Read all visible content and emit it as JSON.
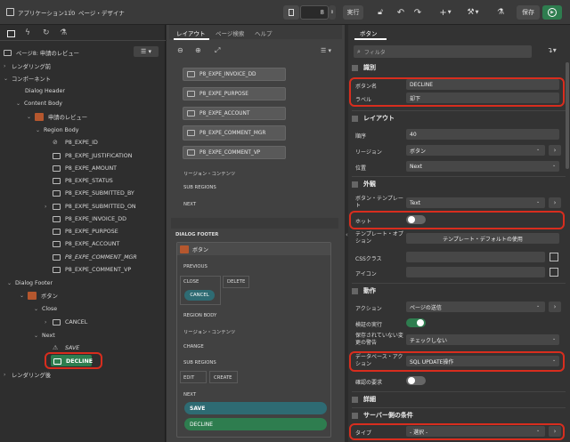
{
  "topbar": {
    "breadcrumb_app": "アプリケーション110",
    "breadcrumb_sep": "\\",
    "breadcrumb_page": "ページ・デザイナ",
    "page_number": "8",
    "run_label": "実行",
    "add_label": "+",
    "save_label": "保存"
  },
  "left": {
    "page_title": "ページ8: 申請のレビュー",
    "items": {
      "rendering_before": "レンダリング前",
      "components": "コンポーネント",
      "dialog_header": "Dialog Header",
      "content_body": "Content Body",
      "region_review": "申請のレビュー",
      "region_body": "Region Body",
      "p8_expe_id": "P8_EXPE_ID",
      "p8_expe_justification": "P8_EXPE_JUSTIFICATION",
      "p8_expe_amount": "P8_EXPE_AMOUNT",
      "p8_expe_status": "P8_EXPE_STATUS",
      "p8_expe_submitted_by": "P8_EXPE_SUBMITTED_BY",
      "p8_expe_submitted_on": "P8_EXPE_SUBMITTED_ON",
      "p8_expe_invoice_dd": "P8_EXPE_INVOICE_DD",
      "p8_expe_purpose": "P8_EXPE_PURPOSE",
      "p8_expe_account": "P8_EXPE_ACCOUNT",
      "p8_expe_comment_mgr": "P8_EXPE_COMMENT_MGR",
      "p8_expe_comment_vp": "P8_EXPE_COMMENT_VP",
      "dialog_footer": "Dialog Footer",
      "region_buttons": "ボタン",
      "close": "Close",
      "cancel": "CANCEL",
      "next": "Next",
      "save": "SAVE",
      "decline": "DECLINE",
      "rendering_after": "レンダリング後"
    }
  },
  "mid": {
    "tabs": [
      "レイアウト",
      "ページ検索",
      "ヘルプ"
    ],
    "items": [
      "P8_EXPE_INVOICE_DD",
      "P8_EXPE_PURPOSE",
      "P8_EXPE_ACCOUNT",
      "P8_EXPE_COMMENT_MGR",
      "P8_EXPE_COMMENT_VP"
    ],
    "region_content": "リージョン・コンテンツ",
    "sub_regions": "SUB REGIONS",
    "next": "NEXT",
    "dialog_footer": "DIALOG FOOTER",
    "buttons_region": "ボタン",
    "previous": "PREVIOUS",
    "close": "CLOSE",
    "delete": "DELETE",
    "cancel": "CANCEL",
    "region_body": "REGION BODY",
    "region_content2": "リージョン・コンテンツ",
    "change": "CHANGE",
    "sub_regions2": "SUB REGIONS",
    "edit": "EDIT",
    "create": "CREATE",
    "next2": "NEXT",
    "save": "SAVE",
    "decline": "DECLINE"
  },
  "right": {
    "tab": "ボタン",
    "filter_placeholder": "フィルタ",
    "sections": {
      "identification": "識別",
      "layout": "レイアウト",
      "appearance": "外観",
      "behavior": "動作",
      "advanced": "詳細",
      "server_condition": "サーバー側の条件"
    },
    "props": {
      "button_name_label": "ボタン名",
      "button_name": "DECLINE",
      "label_label": "ラベル",
      "label": "却下",
      "sequence_label": "順序",
      "sequence": "40",
      "region_label": "リージョン",
      "region": "ボタン",
      "position_label": "位置",
      "position": "Next",
      "template_label": "ボタン・テンプレート",
      "template": "Text",
      "hot_label": "ホット",
      "template_options_label": "テンプレート・オプション",
      "template_options_button": "テンプレート・デフォルトの使用",
      "css_label": "CSSクラス",
      "icon_label": "アイコン",
      "action_label": "アクション",
      "action": "ページの送信",
      "validate_label": "検証の実行",
      "unsaved_label": "保存されていない変更の警告",
      "unsaved": "チェックしない",
      "db_action_label": "データベース・アクション",
      "db_action": "SQL UPDATE操作",
      "confirm_label": "確認の要求",
      "type_label": "タイプ",
      "type": "- 選択 -"
    }
  },
  "colors": {
    "accent_green": "#2e7d4f",
    "highlight_red": "#d82d1e",
    "save_teal": "#2e6b73"
  }
}
